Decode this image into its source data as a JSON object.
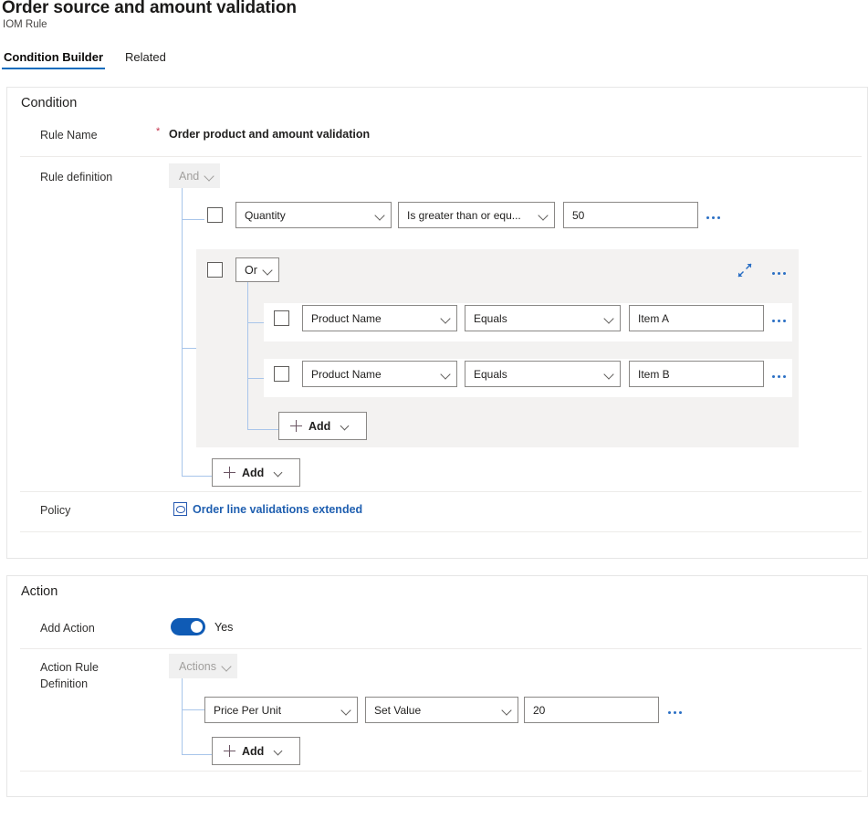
{
  "header": {
    "title": "Order source and amount validation",
    "subtitle": "IOM Rule",
    "tabs": [
      {
        "label": "Condition Builder",
        "active": true
      },
      {
        "label": "Related",
        "active": false
      }
    ]
  },
  "condition": {
    "section_title": "Condition",
    "rule_name": {
      "label": "Rule Name",
      "required_marker": "*",
      "value": "Order product and amount validation"
    },
    "rule_definition": {
      "label": "Rule definition",
      "root_operator": "And",
      "rows": [
        {
          "field": "Quantity",
          "operator": "Is greater than or equ...",
          "value": "50",
          "more_menu": "•••"
        }
      ],
      "group": {
        "operator": "Or",
        "collapse_icon": "collapse-icon",
        "more_menu": "•••",
        "rows": [
          {
            "field": "Product Name",
            "operator": "Equals",
            "value": "Item A",
            "more_menu": "•••"
          },
          {
            "field": "Product Name",
            "operator": "Equals",
            "value": "Item B",
            "more_menu": "•••"
          }
        ],
        "add_label": "Add"
      },
      "add_label": "Add"
    },
    "policy": {
      "label": "Policy",
      "link_text": "Order line validations extended",
      "icon": "policy-icon"
    }
  },
  "action": {
    "section_title": "Action",
    "add_action": {
      "label": "Add Action",
      "toggle_state": "Yes"
    },
    "action_rule_definition": {
      "label_line1": "Action Rule",
      "label_line2": "Definition",
      "root_operator": "Actions",
      "rows": [
        {
          "field": "Price Per Unit",
          "operator": "Set Value",
          "value": "20",
          "more_menu": "•••"
        }
      ],
      "add_label": "Add"
    }
  },
  "colors": {
    "accent": "#0f6cbd",
    "link": "#1f5fb0",
    "required": "#c4314b",
    "tree_line": "#a8c5ea",
    "group_bg": "#f3f2f1",
    "toggle_on": "#0f5bb5"
  }
}
